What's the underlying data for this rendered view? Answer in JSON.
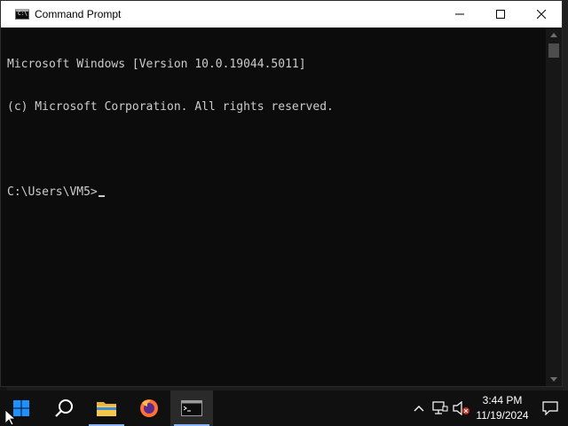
{
  "window": {
    "title": "Command Prompt",
    "icon": "cmd-icon",
    "icon_glyph": "C:\\",
    "controls": [
      "minimize-icon",
      "maximize-icon",
      "close-icon"
    ]
  },
  "console": {
    "lines": [
      "Microsoft Windows [Version 10.0.19044.5011]",
      "(c) Microsoft Corporation. All rights reserved.",
      "",
      "C:\\Users\\VM5>"
    ],
    "text_color": "#cccccc",
    "background": "#0c0c0c"
  },
  "taskbar": {
    "items": [
      {
        "name": "start-button",
        "icon": "windows-logo-icon"
      },
      {
        "name": "search-button",
        "icon": "search-icon"
      },
      {
        "name": "file-explorer-button",
        "icon": "folder-icon"
      },
      {
        "name": "firefox-button",
        "icon": "firefox-icon"
      },
      {
        "name": "command-prompt-button",
        "icon": "terminal-icon",
        "active": true
      }
    ],
    "tray": {
      "icons": [
        "chevron-up-icon",
        "network-icon",
        "volume-muted-icon"
      ],
      "time": "3:44 PM",
      "date": "11/19/2024",
      "notification_icon": "notification-icon"
    },
    "accent": "#8ab4f8"
  }
}
